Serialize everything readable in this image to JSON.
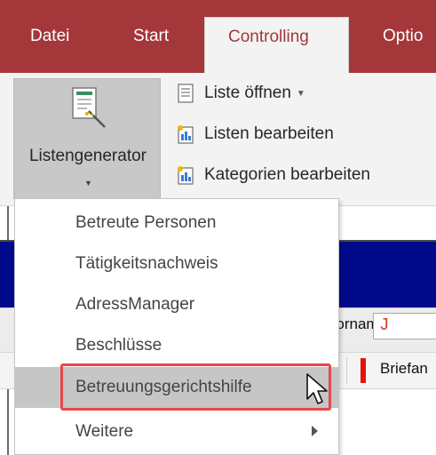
{
  "tabs": [
    "Datei",
    "Start",
    "Controlling",
    "Optio"
  ],
  "active_tab": "Controlling",
  "ribbon": {
    "big_button": {
      "label": "Listengenerator",
      "icon": "list-generator-icon"
    },
    "commands": [
      {
        "label": "Liste öffnen",
        "icon": "list-document-icon",
        "has_dropdown": true
      },
      {
        "label": "Listen bearbeiten",
        "icon": "list-edit-icon"
      },
      {
        "label": "Kategorien bearbeiten",
        "icon": "category-edit-icon"
      }
    ]
  },
  "menu": {
    "items": [
      {
        "label": "Betreute Personen"
      },
      {
        "label": "Tätigkeitsnachweis"
      },
      {
        "label": "AdressManager"
      },
      {
        "label": "Beschlüsse"
      },
      {
        "label": "Betreuungsgerichtshilfe",
        "hovered": true
      },
      {
        "label": "Weitere",
        "submenu": true
      }
    ]
  },
  "background_form": {
    "field_label": "Vorname",
    "field_value": "J",
    "column_partial": "e",
    "column_label": "Briefan"
  },
  "colors": {
    "tab_bar": "#a4373a",
    "ribbon_bg": "#f3f3f3",
    "highlight_border": "#e8474c",
    "form_header": "#020a8c"
  }
}
